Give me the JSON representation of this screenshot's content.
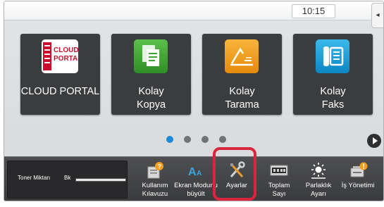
{
  "status": {
    "time": "10:15",
    "side_tab_glyph": "◂"
  },
  "tiles": [
    {
      "name": "cloud-portal",
      "label_line1": "CLOUD PORTAL",
      "label_line2": "",
      "icon": "cloud-portal-icon",
      "logo_line1": "CLOUD",
      "logo_line2": "PORTAL",
      "color": "#c8102e"
    },
    {
      "name": "easy-copy",
      "label_line1": "Kolay",
      "label_line2": "Kopya",
      "icon": "copy-icon",
      "color": "#3fa535"
    },
    {
      "name": "easy-scan",
      "label_line1": "Kolay",
      "label_line2": "Tarama",
      "icon": "scan-icon",
      "color": "#f29e1b"
    },
    {
      "name": "easy-fax",
      "label_line1": "Kolay",
      "label_line2": "Faks",
      "icon": "fax-icon",
      "color": "#1aa4db"
    }
  ],
  "pager": {
    "page_count": 4,
    "active_page": 1,
    "accent": "#1e8ad8"
  },
  "toner": {
    "label": "Toner Miktarı",
    "color_code": "Bk",
    "level": 1.0
  },
  "functions": [
    {
      "name": "user-manual",
      "line1": "Kullanım",
      "line2": "Kılavuzu",
      "icon": "manual-icon"
    },
    {
      "name": "screen-magnify",
      "line1": "Ekran Modunu",
      "line2": "büyült",
      "icon": "magnify-text-icon"
    },
    {
      "name": "settings",
      "line1": "Ayarlar",
      "line2": "",
      "icon": "wrench-screwdriver-icon"
    },
    {
      "name": "total-count",
      "line1": "Toplam",
      "line2": "Sayı",
      "icon": "counter-icon"
    },
    {
      "name": "brightness",
      "line1": "Parlaklık",
      "line2": "Ayarı",
      "icon": "brightness-icon"
    },
    {
      "name": "job-status",
      "line1": "İş Yönetimi",
      "line2": "",
      "icon": "job-status-icon"
    }
  ],
  "highlight_color": "#d7263d"
}
